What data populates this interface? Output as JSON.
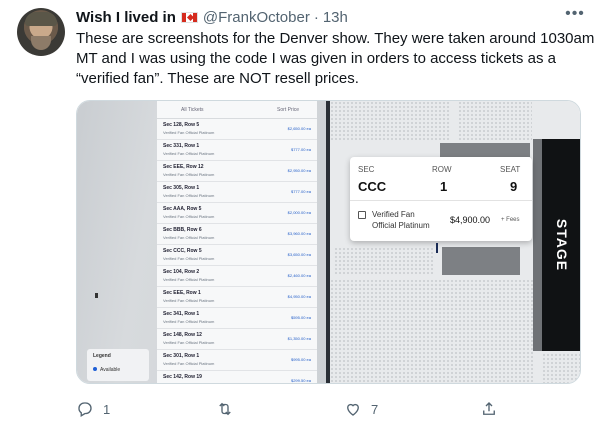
{
  "tweet": {
    "display_name": "Wish I lived in",
    "flag_icon": "canada-flag-icon",
    "handle": "@FrankOctober",
    "separator": "·",
    "time": "13h",
    "text": "These are screenshots for the Denver show. They were taken around 1030am MT and I was using the code I was given in orders to access tickets as a “verified fan”. These are NOT resell prices."
  },
  "left_image": {
    "list_header_left": "All Tickets",
    "list_header_right": "Sort Price",
    "rows": [
      {
        "section": "Sec 128, Row 5",
        "type": "Verified Fan Official Platinum",
        "price": "$2,650.00 ea"
      },
      {
        "section": "Sec 331, Row 1",
        "type": "Verified Fan Official Platinum",
        "price": "$777.00 ea"
      },
      {
        "section": "Sec EEE, Row 12",
        "type": "Verified Fan Official Platinum",
        "price": "$2,950.00 ea"
      },
      {
        "section": "Sec 305, Row 1",
        "type": "Verified Fan Official Platinum",
        "price": "$777.00 ea"
      },
      {
        "section": "Sec AAA, Row 5",
        "type": "Verified Fan Official Platinum",
        "price": "$2,000.00 ea"
      },
      {
        "section": "Sec BBB, Row 6",
        "type": "Verified Fan Official Platinum",
        "price": "$3,960.00 ea"
      },
      {
        "section": "Sec CCC, Row 5",
        "type": "Verified Fan Official Platinum",
        "price": "$3,650.00 ea"
      },
      {
        "section": "Sec 104, Row 2",
        "type": "Verified Fan Official Platinum",
        "price": "$2,460.00 ea"
      },
      {
        "section": "Sec EEE, Row 1",
        "type": "Verified Fan Official Platinum",
        "price": "$4,950.00 ea"
      },
      {
        "section": "Sec 341, Row 1",
        "type": "Verified Fan Official Platinum",
        "price": "$595.00 ea"
      },
      {
        "section": "Sec 148, Row 12",
        "type": "Verified Fan Official Platinum",
        "price": "$1,350.00 ea"
      },
      {
        "section": "Sec 301, Row 1",
        "type": "Verified Fan Official Platinum",
        "price": "$995.00 ea"
      },
      {
        "section": "Sec 142, Row 19",
        "type": "Verified Fan Onsale",
        "price": "$299.50 ea"
      }
    ],
    "legend_title": "Legend",
    "legend_item": "Available"
  },
  "right_image": {
    "sec_label": "SEC",
    "row_label": "ROW",
    "seat_label": "SEAT",
    "sec_value": "CCC",
    "row_value": "1",
    "seat_value": "9",
    "ticket_type_line1": "Verified Fan",
    "ticket_type_line2": "Official Platinum",
    "price": "$4,900.00",
    "fees": "+ Fees",
    "stage_label": "STAGE"
  },
  "actions": {
    "reply_count": "1",
    "retweet_count": "",
    "like_count": "7"
  },
  "icons": {
    "reply": "reply-icon",
    "retweet": "retweet-icon",
    "like": "heart-icon",
    "share": "share-icon",
    "more": "more-icon"
  }
}
